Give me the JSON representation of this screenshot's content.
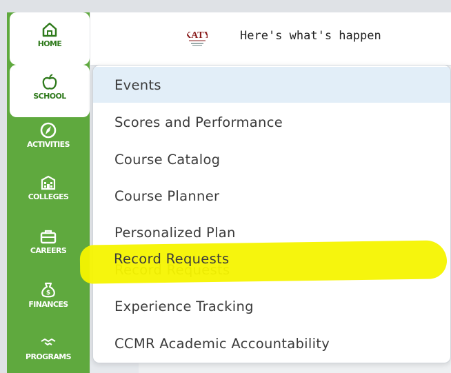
{
  "sidebar": {
    "items": [
      {
        "label": "HOME",
        "icon": "home-icon"
      },
      {
        "label": "SCHOOL",
        "icon": "apple-icon"
      },
      {
        "label": "ACTIVITIES",
        "icon": "compass-icon"
      },
      {
        "label": "COLLEGES",
        "icon": "college-building-icon"
      },
      {
        "label": "CAREERS",
        "icon": "briefcase-icon"
      },
      {
        "label": "FINANCES",
        "icon": "money-bag-icon"
      },
      {
        "label": "PROGRAMS",
        "icon": "handshake-icon"
      }
    ]
  },
  "header": {
    "logo_text": "KATY",
    "message": "Here's what's happen"
  },
  "dropdown": {
    "items": [
      {
        "label": "Events",
        "active": true
      },
      {
        "label": "Scores and Performance"
      },
      {
        "label": "Course Catalog"
      },
      {
        "label": "Course Planner"
      },
      {
        "label": "Personalized Plan"
      },
      {
        "label": "Record Requests",
        "highlighted": true
      },
      {
        "label": "Experience Tracking"
      },
      {
        "label": "CCMR Academic Accountability"
      }
    ]
  },
  "colors": {
    "sidebar_green": "#5fa93e",
    "active_menu": "#e2eef8",
    "highlight_yellow": "#f6f400"
  }
}
